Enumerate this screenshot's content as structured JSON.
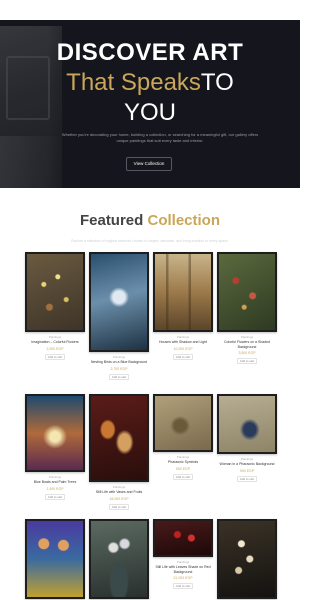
{
  "hero": {
    "title_line1": "DISCOVER ART",
    "title_accent": "That Speaks",
    "title_rest": "TO",
    "title_line3": "YOU",
    "subtitle": "Whether you're decorating your home, building a collection, or searching for a meaningful gift, our gallery offers unique paintings that suit every taste and interior.",
    "button_label": "View Collection",
    "accent_color": "#c9a659",
    "background_color": "#15161d"
  },
  "featured": {
    "title_dark": "Featured",
    "title_accent": "Collection",
    "subtitle": "Explore a selection of original artworks chosen to inspire, decorate, and bring emotion to every space."
  },
  "products": [
    {
      "category": "Paintings",
      "name": "Imagination – Colorful Flowers",
      "price": "2,900 EGP",
      "cart": "Add to cart"
    },
    {
      "category": "Paintings",
      "name": "Nesting Birds on a Blue Background",
      "price": "2,700 EGP",
      "cart": "Add to cart"
    },
    {
      "category": "Paintings",
      "name": "Houses with Shadow and Light",
      "price": "10,000 EGP",
      "cart": "Add to cart"
    },
    {
      "category": "Paintings",
      "name": "Colorful Flowers on a Shaded Background",
      "price": "3,500 EGP",
      "cart": "Add to cart"
    },
    {
      "category": "Paintings",
      "name": "Blue Boats and Palm Trees",
      "price": "1,400 EGP",
      "cart": "Add to cart"
    },
    {
      "category": "Paintings",
      "name": "Still Life with Vases and Fruits",
      "price": "15,000 EGP",
      "cart": "Add to cart"
    },
    {
      "category": "Paintings",
      "name": "Pharaonic Symbols",
      "price": "500 EGP",
      "cart": "Add to cart"
    },
    {
      "category": "Paintings",
      "name": "Woman in a Pharaonic Background",
      "price": "900 EGP",
      "cart": "Add to cart"
    },
    {
      "category": "",
      "name": "",
      "price": "",
      "cart": ""
    },
    {
      "category": "",
      "name": "",
      "price": "",
      "cart": ""
    },
    {
      "category": "Paintings",
      "name": "Still Life with Leaves Shade on Red Background",
      "price": "21,000 EGP",
      "cart": "Add to cart"
    },
    {
      "category": "",
      "name": "",
      "price": "",
      "cart": ""
    }
  ]
}
